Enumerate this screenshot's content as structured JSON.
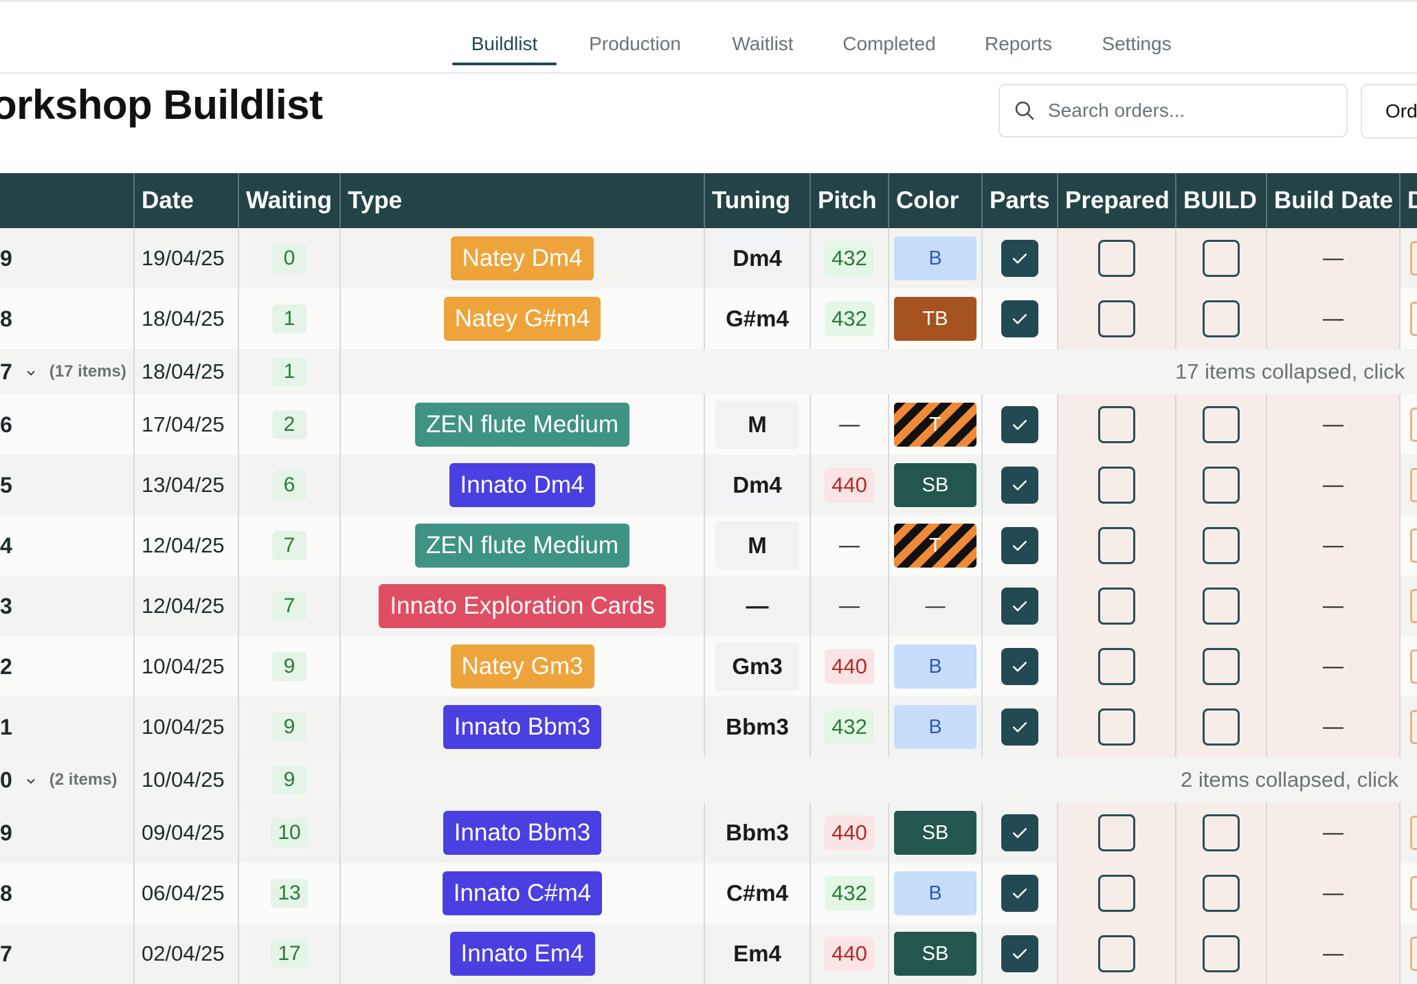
{
  "nav": {
    "tabs": [
      {
        "label": "Buildlist",
        "active": true
      },
      {
        "label": "Production"
      },
      {
        "label": "Waitlist"
      },
      {
        "label": "Completed"
      },
      {
        "label": "Reports"
      },
      {
        "label": "Settings"
      }
    ]
  },
  "page": {
    "title": "orkshop Buildlist",
    "search_placeholder": "Search orders...",
    "orders_button": "Ord"
  },
  "table": {
    "headers": [
      "Date",
      "Waiting",
      "Type",
      "Tuning",
      "Pitch",
      "Color",
      "Parts",
      "Prepared",
      "BUILD",
      "Build Date",
      "D"
    ],
    "rows": [
      {
        "kind": "item",
        "id": "9",
        "date": "19/04/25",
        "waiting": "0",
        "type": "Natey Dm4",
        "type_color": "#eea43a",
        "tuning": "Dm4",
        "pitch": "432",
        "color": {
          "label": "B",
          "style": "light-blue"
        },
        "parts": true,
        "prepared": false,
        "build": false,
        "build_date": "—"
      },
      {
        "kind": "item",
        "id": "8",
        "date": "18/04/25",
        "waiting": "1",
        "type": "Natey G#m4",
        "type_color": "#eea43a",
        "tuning": "G#m4",
        "pitch": "432",
        "color": {
          "label": "TB",
          "style": "brown"
        },
        "parts": true,
        "prepared": false,
        "build": false,
        "build_date": "—"
      },
      {
        "kind": "group",
        "id": "7",
        "count": "(17 items)",
        "date": "18/04/25",
        "waiting": "1",
        "collapsed_text": "17 items collapsed, click"
      },
      {
        "kind": "item",
        "id": "6",
        "date": "17/04/25",
        "waiting": "2",
        "type": "ZEN flute Medium",
        "type_color": "#3f9382",
        "tuning": "M",
        "pitch": "—",
        "color": {
          "label": "T",
          "style": "stripes"
        },
        "parts": true,
        "prepared": false,
        "build": false,
        "build_date": "—"
      },
      {
        "kind": "item",
        "id": "5",
        "date": "13/04/25",
        "waiting": "6",
        "type": "Innato Dm4",
        "type_color": "#4a3fe0",
        "tuning": "Dm4",
        "pitch": "440",
        "color": {
          "label": "SB",
          "style": "dark-teal"
        },
        "parts": true,
        "prepared": false,
        "build": false,
        "build_date": "—"
      },
      {
        "kind": "item",
        "id": "4",
        "date": "12/04/25",
        "waiting": "7",
        "type": "ZEN flute Medium",
        "type_color": "#3f9382",
        "tuning": "M",
        "pitch": "—",
        "color": {
          "label": "T",
          "style": "stripes"
        },
        "parts": true,
        "prepared": false,
        "build": false,
        "build_date": "—"
      },
      {
        "kind": "item",
        "id": "3",
        "date": "12/04/25",
        "waiting": "7",
        "type": "Innato Exploration Cards",
        "type_color": "#e04e63",
        "tuning": "—",
        "pitch": "—",
        "color": {
          "label": "—",
          "style": "none"
        },
        "parts": true,
        "prepared": false,
        "build": false,
        "build_date": "—"
      },
      {
        "kind": "item",
        "id": "2",
        "date": "10/04/25",
        "waiting": "9",
        "type": "Natey Gm3",
        "type_color": "#eea43a",
        "tuning": "Gm3",
        "pitch": "440",
        "color": {
          "label": "B",
          "style": "light-blue"
        },
        "parts": true,
        "prepared": false,
        "build": false,
        "build_date": "—"
      },
      {
        "kind": "item",
        "id": "1",
        "date": "10/04/25",
        "waiting": "9",
        "type": "Innato Bbm3",
        "type_color": "#4a3fe0",
        "tuning": "Bbm3",
        "pitch": "432",
        "color": {
          "label": "B",
          "style": "light-blue"
        },
        "parts": true,
        "prepared": false,
        "build": false,
        "build_date": "—"
      },
      {
        "kind": "group",
        "id": "0",
        "count": "(2 items)",
        "date": "10/04/25",
        "waiting": "9",
        "collapsed_text": "2 items collapsed, click"
      },
      {
        "kind": "item",
        "id": "9",
        "date": "09/04/25",
        "waiting": "10",
        "type": "Innato Bbm3",
        "type_color": "#4a3fe0",
        "tuning": "Bbm3",
        "pitch": "440",
        "color": {
          "label": "SB",
          "style": "dark-teal"
        },
        "parts": true,
        "prepared": false,
        "build": false,
        "build_date": "—"
      },
      {
        "kind": "item",
        "id": "8",
        "date": "06/04/25",
        "waiting": "13",
        "type": "Innato C#m4",
        "type_color": "#4a3fe0",
        "tuning": "C#m4",
        "pitch": "432",
        "color": {
          "label": "B",
          "style": "light-blue"
        },
        "parts": true,
        "prepared": false,
        "build": false,
        "build_date": "—"
      },
      {
        "kind": "item",
        "id": "7",
        "date": "02/04/25",
        "waiting": "17",
        "type": "Innato Em4",
        "type_color": "#4a3fe0",
        "tuning": "Em4",
        "pitch": "440",
        "color": {
          "label": "SB",
          "style": "dark-teal"
        },
        "parts": true,
        "prepared": false,
        "build": false,
        "build_date": "—"
      }
    ]
  }
}
